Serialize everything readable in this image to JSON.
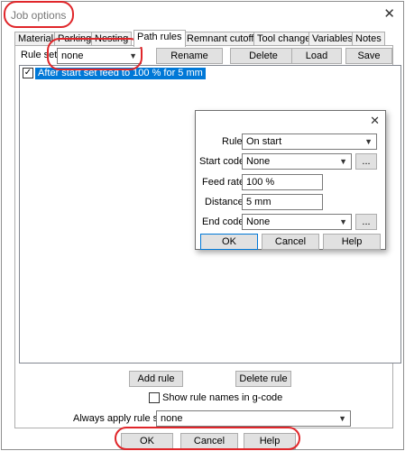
{
  "window": {
    "title": "Job options",
    "close_glyph": "✕"
  },
  "tabs": [
    {
      "label": "Material"
    },
    {
      "label": "Parking"
    },
    {
      "label": "Nesting"
    },
    {
      "label": "Path rules",
      "active": true
    },
    {
      "label": "Remnant cutoff"
    },
    {
      "label": "Tool change"
    },
    {
      "label": "Variables"
    },
    {
      "label": "Notes"
    }
  ],
  "ruleset": {
    "label": "Rule set",
    "value": "none",
    "rename_label": "Rename",
    "delete_label": "Delete",
    "load_label": "Load",
    "save_label": "Save"
  },
  "rules_list": [
    {
      "text": "After start set feed to 100 % for 5 mm",
      "checked": true,
      "selected": true
    }
  ],
  "dialog": {
    "close_glyph": "✕",
    "rule_label": "Rule",
    "rule_value": "On start",
    "start_code_label": "Start code",
    "start_code_value": "None",
    "feed_rate_label": "Feed rate",
    "feed_rate_value": "100 %",
    "distance_label": "Distance",
    "distance_value": "5 mm",
    "end_code_label": "End code",
    "end_code_value": "None",
    "ellipsis": "...",
    "ok_label": "OK",
    "cancel_label": "Cancel",
    "help_label": "Help"
  },
  "bottom": {
    "add_rule_label": "Add rule",
    "delete_rule_label": "Delete rule",
    "show_names_label": "Show rule names in g-code",
    "always_apply_label": "Always apply rule set",
    "always_apply_value": "none",
    "ok_label": "OK",
    "cancel_label": "Cancel",
    "help_label": "Help"
  },
  "icons": {
    "chevron": "chevron-down-icon",
    "check": "✓"
  },
  "colors": {
    "selection": "#0078d7",
    "annotation": "#e0262a",
    "button": "#e1e1e1"
  }
}
